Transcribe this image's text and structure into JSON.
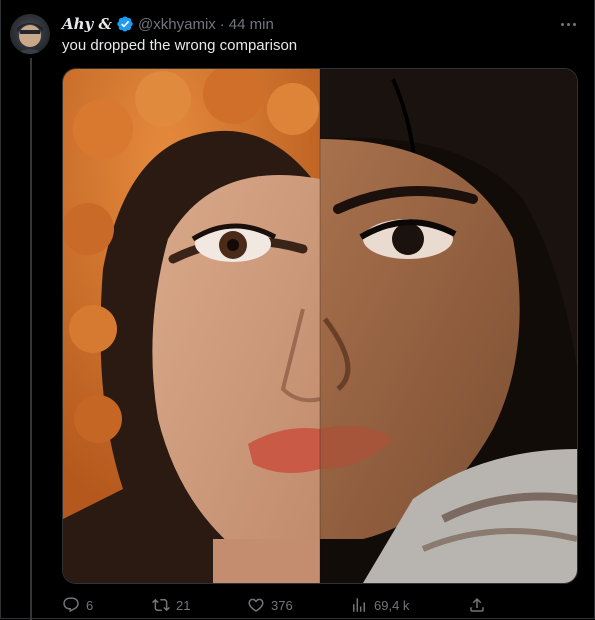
{
  "tweet": {
    "display_name": "Ahy",
    "display_name_suffix": "&",
    "verified_icon": "verified-badge-icon",
    "handle": "@xkhyamix",
    "separator": "·",
    "time": "44 min",
    "text": "you dropped the wrong comparison"
  },
  "actions": {
    "replies": "6",
    "reposts": "21",
    "likes": "376",
    "views": "69,4 k"
  },
  "icons": {
    "reply": "reply-icon",
    "repost": "repost-icon",
    "like": "heart-icon",
    "views": "views-icon",
    "share": "share-icon",
    "more": "more-icon"
  },
  "colors": {
    "background": "#000000",
    "text": "#e7e9ea",
    "muted": "#71767b",
    "verified": "#1d9bf0",
    "divider": "#2f3336"
  }
}
